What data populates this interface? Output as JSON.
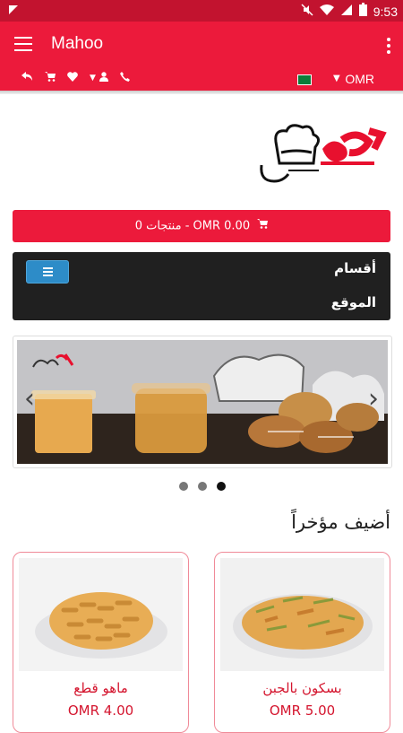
{
  "status": {
    "time": "9:53"
  },
  "app": {
    "title": "Mahoo"
  },
  "topbar": {
    "currency": "OMR"
  },
  "cart": {
    "summary": "0 منتجات - OMR 0.00"
  },
  "categories": {
    "label1": "أقسام",
    "label2": "الموقع"
  },
  "section": {
    "title": "أضيف مؤخراً"
  },
  "products": [
    {
      "name": "بسكون بالجبن",
      "price": "OMR 5.00"
    },
    {
      "name": "ماهو قطع",
      "price": "OMR 4.00"
    }
  ],
  "slider": {
    "dots": 3,
    "active_dot": 3
  },
  "colors": {
    "primary": "#ec1a3b",
    "status": "#c2132f",
    "dark": "#202020",
    "button": "#2d8cc8"
  }
}
